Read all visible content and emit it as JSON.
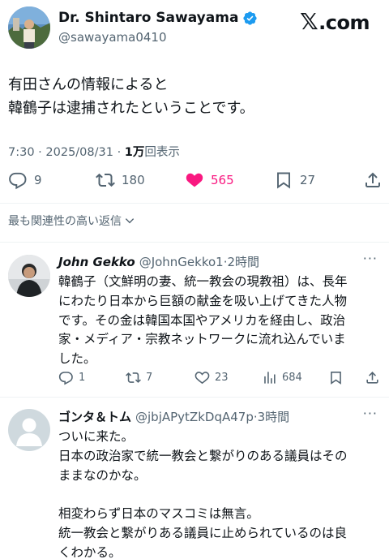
{
  "colors": {
    "text": "#0f1419",
    "muted": "#536471",
    "like": "#f91880",
    "verified": "#1d9bf0",
    "divider": "#eff3f4"
  },
  "brand": {
    "x_glyph": "𝕏",
    "suffix": ".com"
  },
  "tweet": {
    "author_name": "Dr. Shintaro Sawayama",
    "handle": "@sawayama0410",
    "verified_icon": "verified-badge-icon",
    "text_line1": "有田さんの情報によると",
    "text_line2": "韓鶴子は逮捕されたということです。",
    "timestamp": "7:30 · 2025/08/31 · ",
    "views_count": "1万",
    "views_label": "回表示",
    "replies": "9",
    "retweets": "180",
    "likes": "565",
    "bookmarks": "27"
  },
  "sort_label": "最も関連性の高い返信",
  "replies": [
    {
      "name": "John Gekko",
      "handle": "@JohnGekko1",
      "time": "·2時間",
      "more": "···",
      "text_lines": [
        "韓鶴子（文鮮明の妻、統一教会の現教祖）は、長年",
        "にわたり日本から巨額の献金を吸い上げてきた人物",
        "です。その金は韓国本国やアメリカを経由し、政治",
        "家・メディア・宗教ネットワークに流れ込んでいま",
        "した。"
      ],
      "reply_count": "1",
      "retweet_count": "7",
      "like_count": "23",
      "view_count": "684"
    },
    {
      "name": "ゴンタ＆トム",
      "handle": "@jbjAPytZkDqA47p",
      "time": "·3時間",
      "more": "···",
      "text_lines": [
        "ついに来た。",
        "日本の政治家で統一教会と繋がりのある議員はその",
        "ままなのかな。",
        "",
        "相変わらず日本のマスコミは無言。",
        "統一教会と繋がりある議員に止められているのは良",
        "くわかる。"
      ]
    }
  ]
}
